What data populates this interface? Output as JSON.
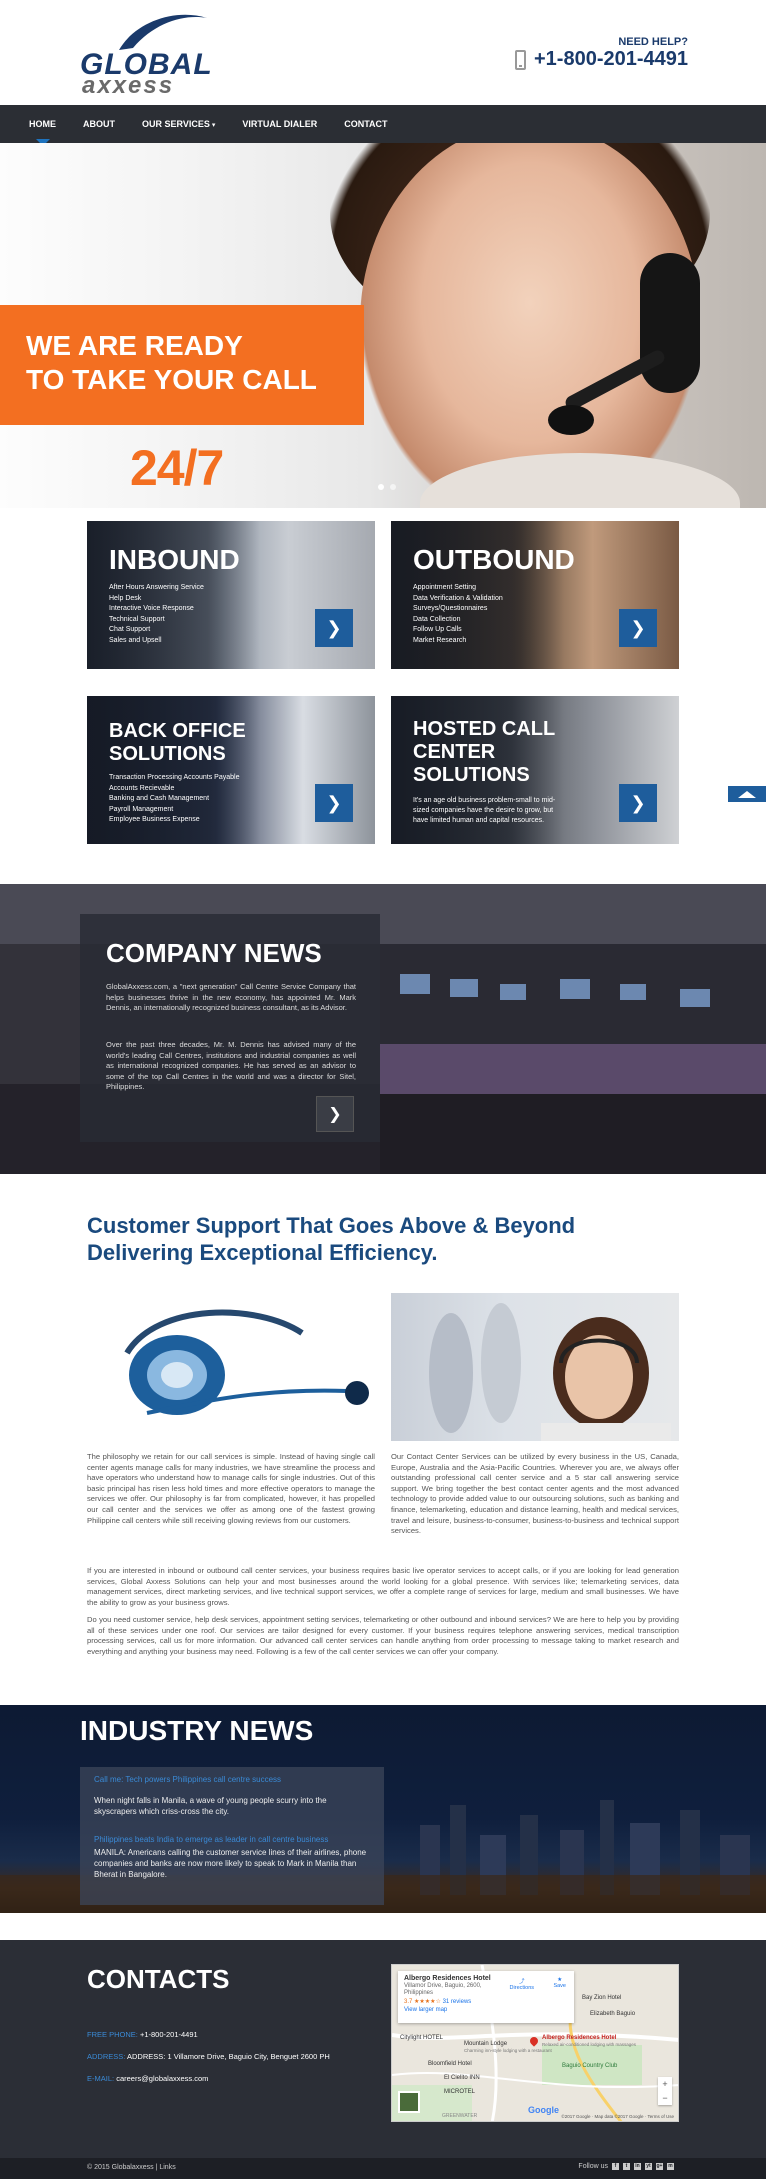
{
  "header": {
    "logo_top": "GLOBAL",
    "logo_bottom": "axxess",
    "need_help": "NEED HELP?",
    "phone": "+1-800-201-4491",
    "phone_icon": "mobile-phone-icon"
  },
  "nav": {
    "items": [
      {
        "label": "HOME"
      },
      {
        "label": "ABOUT"
      },
      {
        "label": "OUR SERVICES"
      },
      {
        "label": "VIRTUAL DIALER"
      },
      {
        "label": "CONTACT"
      }
    ],
    "caret": "▾",
    "active_color": "#1e73be"
  },
  "hero": {
    "line1": "WE ARE READY",
    "line2": "TO TAKE YOUR CALL",
    "availability": "24/7",
    "accent_color": "#f36f21"
  },
  "services": {
    "inbound": {
      "title": "INBOUND",
      "items": [
        "After Hours Answering Service",
        "Help Desk",
        "Interactive Voice Response",
        "Technical Support",
        "Chat Support",
        "Sales and Upsell"
      ]
    },
    "outbound": {
      "title": "OUTBOUND",
      "items": [
        "Appointment Setting",
        "Data Verification & Validation",
        "Surveys/Questionnaires",
        "Data Collection",
        "Follow Up Calls",
        "Market Research"
      ]
    },
    "back_office": {
      "title_line1": "BACK OFFICE",
      "title_line2": "SOLUTIONS",
      "items": [
        "Transaction Processing Accounts Payable",
        "Accounts Recievable",
        "Banking and Cash Management",
        "Payroll Management",
        "Employee Business Expense"
      ]
    },
    "hosted": {
      "title_line1": "HOSTED CALL",
      "title_line2": "CENTER",
      "title_line3": "SOLUTIONS",
      "description": "It's an age old business problem-small to mid-sized companies have the desire to grow, but have limited human and capital resources."
    },
    "arrow": "❯",
    "button_color": "#1e5d9c"
  },
  "company_news": {
    "title": "COMPANY NEWS",
    "p1": "GlobalAxxess.com, a \"next generation\" Call Centre Service Company that helps businesses thrive in the new economy, has appointed Mr. Mark Dennis, an internationally recognized business consultant, as its Advisor.",
    "p2": "Over the past three decades, Mr. M. Dennis has advised many of the world's leading Call Centres, institutions and industrial companies as well as international recognized companies. He has served as an advisor to some of the top Call Centres in the world and was a director for Sitel, Philippines.",
    "arrow": "❯"
  },
  "customer_support": {
    "heading_line1": "Customer Support That Goes Above & Beyond",
    "heading_line2": "Delivering Exceptional Efficiency.",
    "col_left": "The philosophy we retain for our call services is simple. Instead of having single call center agents manage calls for many industries, we have streamline the process and have operators who understand how to manage calls for single industries. Out of this basic principal has risen less hold times and more effective operators to manage the services we offer. Our philosophy is far from complicated, however, it has propelled our call center and the services we offer as among one of the fastest growing Philippine call centers while still receiving glowing reviews from our customers.",
    "col_right": "Our Contact Center Services can be utilized by every business in the US, Canada, Europe, Australia and the Asia-Pacific Countries. Wherever you are, we always offer outstanding professional call center service and a 5 star call answering service support. We bring together the best contact center agents and the most advanced technology to provide added value to our outsourcing solutions, such as banking and finance, telemarketing, education and distance learning, health and medical services, travel and leisure, business-to-consumer, business-to-business and technical support services.",
    "para2": "If you are interested in inbound or outbound call center services, your business requires basic live operator services to accept calls, or if you are looking for lead generation services, Global Axxess Solutions can help your and most businesses around the world looking for a global presence. With services like; telemarketing services, data management services, direct marketing services, and live technical support services, we offer a complete range of services for large, medium and small businesses. We have the ability to grow as your business grows.",
    "para3": "Do you need customer service, help desk services, appointment setting services, telemarketing or other outbound and inbound services? We are here to help you by providing all of these services under one roof. Our services are tailor designed for every customer. If your business requires telephone answering services, medical transcription processing services, call us for more information. Our advanced call center services can handle anything from order processing to message taking to market research and everything and anything your business may need. Following is a few of the call center services we can offer your company."
  },
  "industry_news": {
    "title": "INDUSTRY NEWS",
    "item1_link": "Call me: Tech powers Philippines call centre success",
    "item1_text": "When night falls in Manila, a wave of young people scurry into the skyscrapers which criss-cross the city.",
    "item2_link": "Philippines beats India to emerge as leader in call centre business",
    "item2_text": "MANILA: Americans calling the customer service lines of their airlines, phone companies and banks are now more likely to speak to Mark in Manila than Bherat in Bangalore."
  },
  "contacts": {
    "title": "CONTACTS",
    "phone_label": "FREE PHONE:",
    "phone_value": "+1-800-201-4491",
    "address_label": "ADDRESS:",
    "address_value": "ADDRESS: 1 Villamore Drive, Baguio City, Benguet 2600 PH",
    "email_label": "E-MAIL:",
    "email_value": "careers@globalaxxess.com"
  },
  "map": {
    "place_name": "Albergo Residences Hotel",
    "place_address": "Villamor Drive, Baguio, 2600, Philippines",
    "rating": "3.7",
    "stars": "★★★★☆",
    "reviews": "31 reviews",
    "larger_map": "View larger map",
    "directions": "Directions",
    "save": "Save",
    "labels": {
      "ryzion": "Bay Zion Hotel",
      "elizabeth": "Elizabeth Baguio",
      "mountain_lodge": "Mountain Lodge",
      "mountain_lodge_sub": "Charming inn-style lodging with a restaurant",
      "albergo_pin": "Albergo Residences Hotel",
      "albergo_sub": "Relaxed air-conditioned lodging with massages",
      "citylight": "Citylight HOTEL",
      "bloomfield": "Bloomfield Hotel",
      "el_cielito": "El Cielito INN",
      "microtel": "MICROTEL",
      "country_club": "Baguio Country Club",
      "greenwater": "GREENWATER"
    },
    "google": "Google",
    "footer_text": "©2017 Google · Map data ©2017 Google · Terms of Use",
    "zoom_in": "+",
    "zoom_out": "−"
  },
  "footer": {
    "copyright": "© 2015   Globalaxxess | Links",
    "follow": "Follow us",
    "socials": [
      "f",
      "t",
      "in",
      "yt",
      "g+",
      "m"
    ]
  }
}
